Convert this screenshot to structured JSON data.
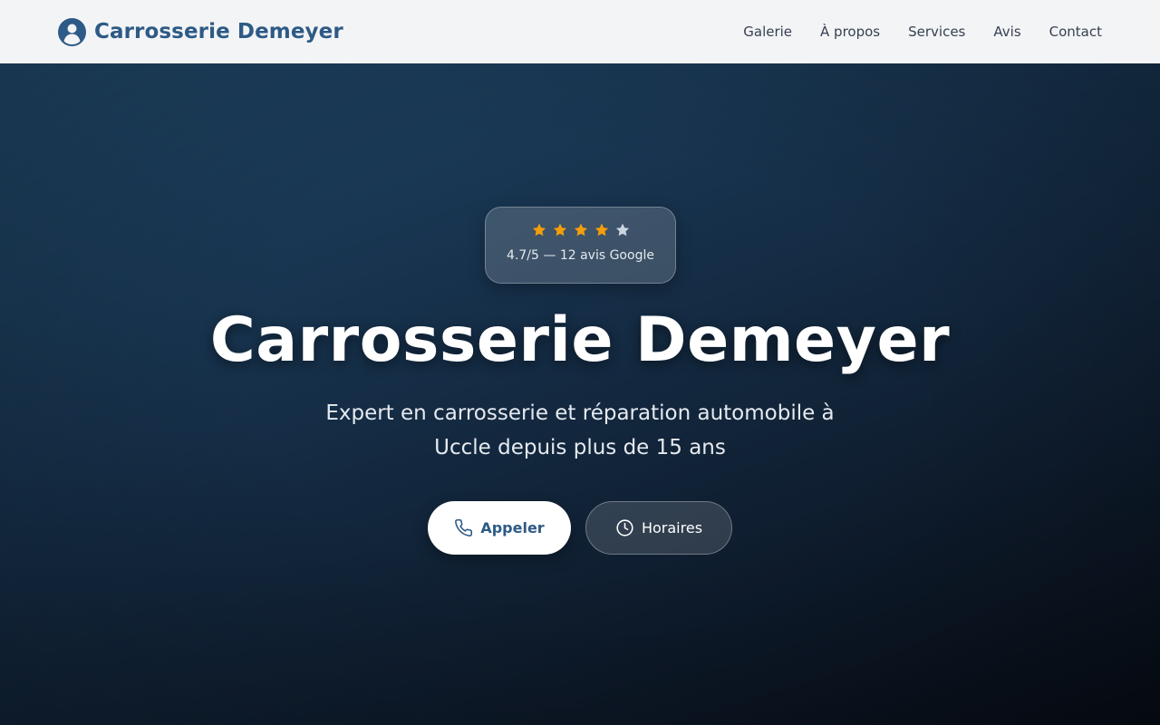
{
  "header": {
    "brand_name": "Carrosserie Demeyer",
    "logo_icon": "user-circle-icon",
    "nav": [
      "Galerie",
      "À propos",
      "Services",
      "Avis",
      "Contact"
    ]
  },
  "hero": {
    "rating": {
      "stars_total": 5,
      "stars_filled": 4,
      "text": "4.7/5 — 12 avis Google"
    },
    "title": "Carrosserie Demeyer",
    "subtitle": "Expert en carrosserie et réparation automobile à Uccle depuis plus de 15 ans",
    "buttons": {
      "call": {
        "label": "Appeler",
        "icon": "phone-icon"
      },
      "hours": {
        "label": "Horaires",
        "icon": "clock-icon"
      }
    }
  },
  "colors": {
    "brand": "#2d5a86",
    "star_filled": "#f59e0b",
    "star_empty": "#cbd5e1",
    "header_bg": "#f3f4f6"
  }
}
